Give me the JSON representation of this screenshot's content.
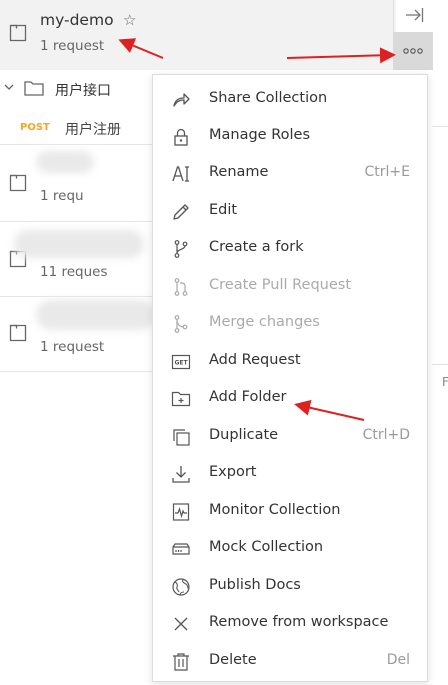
{
  "active_collection": {
    "name": "my-demo",
    "star_glyph": "☆",
    "subtitle": "1 request"
  },
  "folder": {
    "name": "用户接口"
  },
  "request": {
    "method": "POST",
    "name": "用户注册"
  },
  "collections": [
    {
      "subtitle": "1 requ"
    },
    {
      "subtitle": "11 reques"
    },
    {
      "subtitle": "1 request"
    }
  ],
  "side_buttons": {
    "collapse_glyph": "|→",
    "more_glyph": "ooo"
  },
  "right_edge_text": "F",
  "menu": {
    "items": [
      {
        "label": "Share Collection",
        "icon": "share-icon",
        "shortcut": "",
        "disabled": false
      },
      {
        "label": "Manage Roles",
        "icon": "lock-icon",
        "shortcut": "",
        "disabled": false
      },
      {
        "label": "Rename",
        "icon": "rename-icon",
        "shortcut": "Ctrl+E",
        "disabled": false
      },
      {
        "label": "Edit",
        "icon": "pencil-icon",
        "shortcut": "",
        "disabled": false
      },
      {
        "label": "Create a fork",
        "icon": "fork-icon",
        "shortcut": "",
        "disabled": false
      },
      {
        "label": "Create Pull Request",
        "icon": "pull-request-icon",
        "shortcut": "",
        "disabled": true
      },
      {
        "label": "Merge changes",
        "icon": "merge-icon",
        "shortcut": "",
        "disabled": true
      },
      {
        "label": "Add Request",
        "icon": "get-request-icon",
        "icon_text": "GET",
        "shortcut": "",
        "disabled": false
      },
      {
        "label": "Add Folder",
        "icon": "folder-plus-icon",
        "shortcut": "",
        "disabled": false
      },
      {
        "label": "Duplicate",
        "icon": "duplicate-icon",
        "shortcut": "Ctrl+D",
        "disabled": false
      },
      {
        "label": "Export",
        "icon": "export-icon",
        "shortcut": "",
        "disabled": false
      },
      {
        "label": "Monitor Collection",
        "icon": "monitor-icon",
        "shortcut": "",
        "disabled": false
      },
      {
        "label": "Mock Collection",
        "icon": "mock-server-icon",
        "shortcut": "",
        "disabled": false
      },
      {
        "label": "Publish Docs",
        "icon": "globe-icon",
        "shortcut": "",
        "disabled": false
      },
      {
        "label": "Remove from workspace",
        "icon": "close-icon",
        "shortcut": "",
        "disabled": false
      },
      {
        "label": "Delete",
        "icon": "trash-icon",
        "shortcut": "Del",
        "disabled": false
      }
    ]
  },
  "colors": {
    "annotation_arrow": "#e02020",
    "post_method": "#f5a623",
    "disabled_text": "#aaaaaa"
  }
}
